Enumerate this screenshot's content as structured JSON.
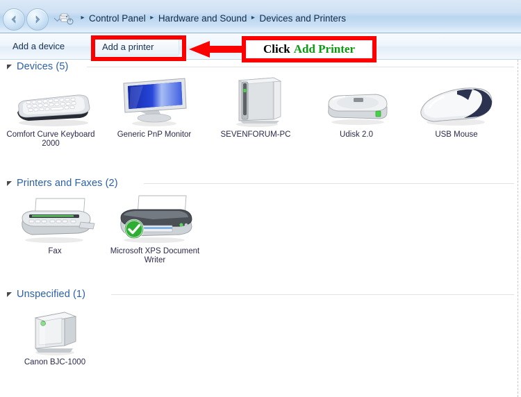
{
  "window": {
    "title": "Devices and Printers"
  },
  "addressbar": {
    "back_icon": "back-arrow-icon",
    "forward_icon": "forward-arrow-icon",
    "history_icon": "chevron-down-icon",
    "location_icon": "devices-and-printers-icon",
    "separator": "▸",
    "crumbs": [
      {
        "label": "Control Panel"
      },
      {
        "label": "Hardware and Sound"
      },
      {
        "label": "Devices and Printers"
      }
    ]
  },
  "toolbar": {
    "add_device_label": "Add a device",
    "add_printer_label": "Add a printer"
  },
  "sections": [
    {
      "id": "devices",
      "title": "Devices (5)",
      "collapse_icon": "triangle-expanded-icon",
      "items": [
        {
          "name": "Comfort Curve Keyboard 2000",
          "icon": "keyboard-icon"
        },
        {
          "name": "Generic PnP Monitor",
          "icon": "monitor-icon"
        },
        {
          "name": "SEVENFORUM-PC",
          "icon": "desktop-computer-icon"
        },
        {
          "name": "Udisk 2.0",
          "icon": "usb-drive-icon"
        },
        {
          "name": "USB Mouse",
          "icon": "mouse-icon"
        }
      ]
    },
    {
      "id": "printers-and-faxes",
      "title": "Printers and Faxes (2)",
      "collapse_icon": "triangle-expanded-icon",
      "items": [
        {
          "name": "Fax",
          "icon": "fax-icon"
        },
        {
          "name": "Microsoft XPS Document Writer",
          "icon": "printer-icon",
          "badge": "default-printer-check-icon"
        }
      ]
    },
    {
      "id": "unspecified",
      "title": "Unspecified (1)",
      "collapse_icon": "triangle-expanded-icon",
      "items": [
        {
          "name": "Canon BJC-1000",
          "icon": "generic-device-icon"
        }
      ]
    }
  ],
  "annotation": {
    "callout_word_1": "Click",
    "callout_word_2": "Add Printer",
    "arrow_icon": "left-arrow-annotation-icon",
    "highlight_color": "#fc0000",
    "click_text_color": "#000000",
    "target_text_color": "#0a9b10"
  }
}
